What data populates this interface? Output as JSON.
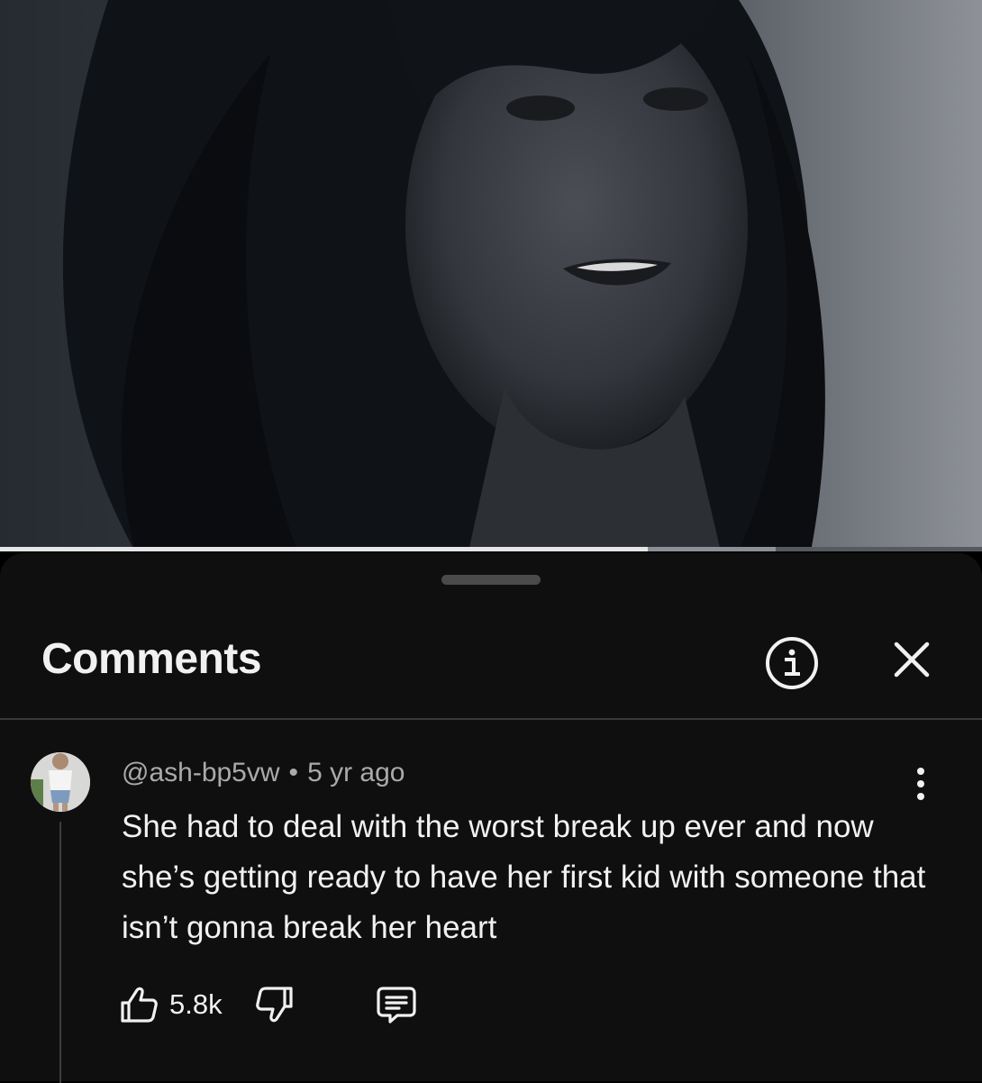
{
  "video": {
    "progress_played": 0.66,
    "progress_buffered": 0.79
  },
  "comments_panel": {
    "title": "Comments",
    "info_icon": "info-circle-icon",
    "close_icon": "close-icon"
  },
  "comment": {
    "author": "@ash-bp5vw",
    "separator": "•",
    "age": "5 yr ago",
    "text": "She had to deal with the worst break up ever and now she’s getting ready to have her first kid with someone that isn’t gonna break her heart",
    "like_count": "5.8k",
    "icons": {
      "like": "thumbs-up-icon",
      "dislike": "thumbs-down-icon",
      "reply": "reply-comment-icon",
      "more": "more-vertical-icon"
    }
  },
  "colors": {
    "sheet_background": "#0f0f0f",
    "primary_text": "#f1f1f1",
    "secondary_text": "#aaaaaa",
    "divider": "#3a3a3a"
  }
}
